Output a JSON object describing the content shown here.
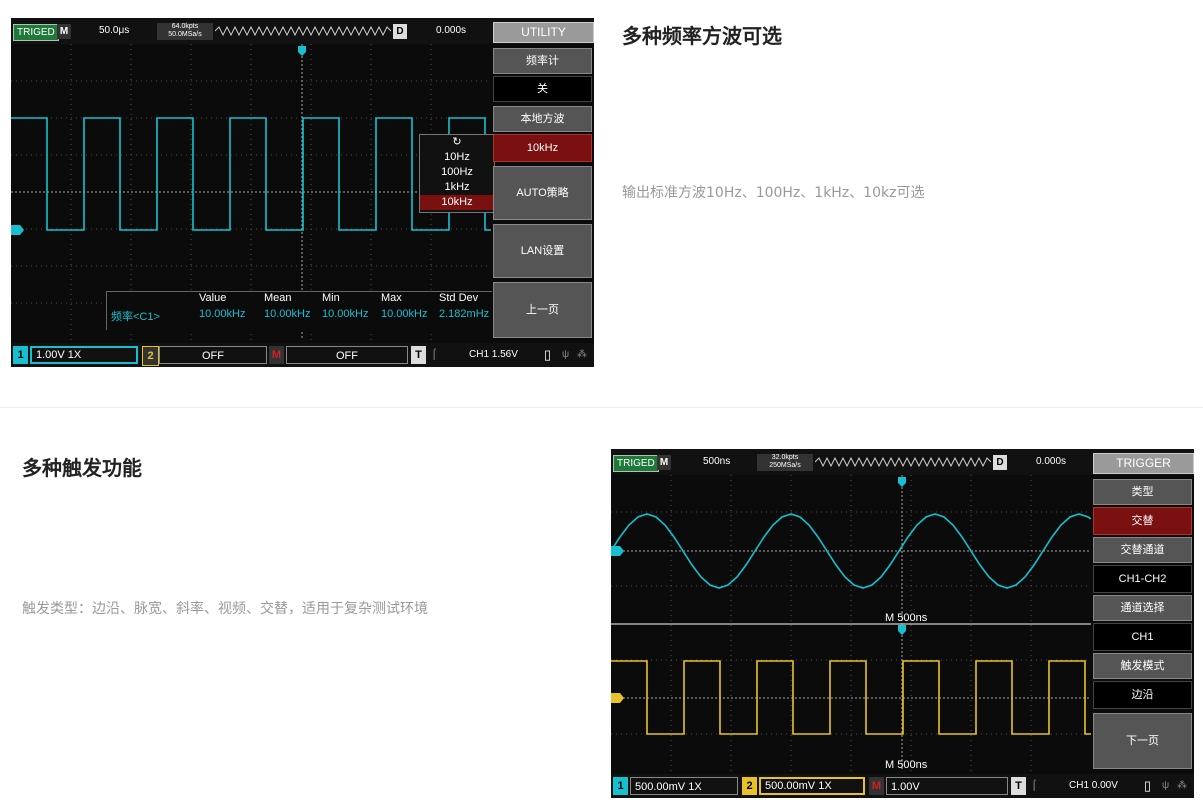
{
  "section1": {
    "heading": "多种频率方波可选",
    "description": "输出标准方波10Hz、100Hz、1kHz、10kz可选",
    "scope": {
      "status": "TRIGED",
      "mode": "M",
      "timebase": "50.0μs",
      "kpts": "64.0kpts",
      "sample_rate": "50.0MSa/s",
      "delay_label": "D",
      "delay_value": "0.000s",
      "menu_title": "UTILITY",
      "menu": {
        "freq_counter_label": "频率计",
        "freq_counter_value": "关",
        "local_square_label": "本地方波",
        "local_square_value": "10kHz",
        "auto_policy": "AUTO策略",
        "lan_settings": "LAN设置",
        "prev_page": "上一页"
      },
      "freq_popup": {
        "refresh_icon": "↻",
        "options": [
          "10Hz",
          "100Hz",
          "1kHz",
          "10kHz"
        ],
        "selected": "10kHz"
      },
      "measurement": {
        "headers": [
          "Value",
          "Mean",
          "Min",
          "Max",
          "Std Dev"
        ],
        "row_label": "频率<C1>",
        "values": [
          "10.00kHz",
          "10.00kHz",
          "10.00kHz",
          "10.00kHz",
          "2.182mHz"
        ]
      },
      "bottom": {
        "ch1_num": "1",
        "ch1_value": "1.00V  1X",
        "ch2_num": "2",
        "ch2_value": "OFF",
        "math_label": "M",
        "math_value": "OFF",
        "trigger_label": "T",
        "trigger_value": "CH1  1.56V"
      },
      "colors": {
        "ch1": "#17c0d0",
        "ch2": "#e8c228",
        "math": "#d02020"
      }
    }
  },
  "section2": {
    "heading": "多种触发功能",
    "description": "触发类型：边沿、脉宽、斜率、视频、交替，适用于复杂测试环境",
    "scope": {
      "status": "TRIGED",
      "mode": "M",
      "timebase": "500ns",
      "kpts": "32.0kpts",
      "sample_rate": "250MSa/s",
      "delay_label": "D",
      "delay_value": "0.000s",
      "menu_title": "TRIGGER",
      "menu": {
        "type_label": "类型",
        "type_value": "交替",
        "alt_channel_label": "交替通道",
        "alt_channel_value": "CH1-CH2",
        "channel_select_label": "通道选择",
        "channel_select_value": "CH1",
        "trigger_mode_label": "触发模式",
        "trigger_mode_value": "边沿",
        "next_page": "下一页"
      },
      "pane_label_top": "M 500ns",
      "pane_label_bottom": "M 500ns",
      "bottom": {
        "ch1_num": "1",
        "ch1_value": "500.00mV  1X",
        "ch2_num": "2",
        "ch2_value": "500.00mV  1X",
        "math_label": "M",
        "math_value": "1.00V",
        "trigger_label": "T",
        "trigger_value": "CH1  0.00V"
      }
    }
  }
}
